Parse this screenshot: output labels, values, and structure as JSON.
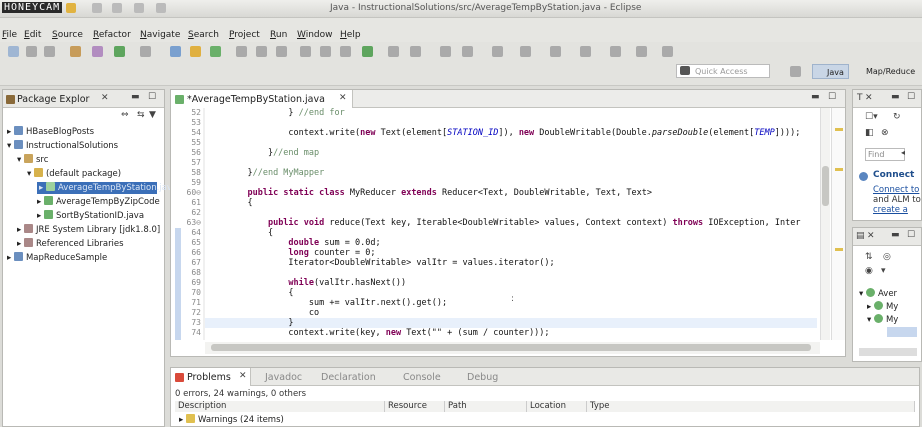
{
  "watermark": "HONEYCAM",
  "window_title": "Java - InstructionalSolutions/src/AverageTempByStation.java - Eclipse",
  "menu": [
    "File",
    "Edit",
    "Source",
    "Refactor",
    "Navigate",
    "Search",
    "Project",
    "Run",
    "Window",
    "Help"
  ],
  "quick_access_placeholder": "Quick Access",
  "perspectives": [
    "Java",
    "Map/Reduce"
  ],
  "package_explorer": {
    "title": "Package Explor",
    "items": [
      {
        "label": "HBaseBlogPosts",
        "level": 0
      },
      {
        "label": "InstructionalSolutions",
        "level": 0
      },
      {
        "label": "src",
        "level": 1
      },
      {
        "label": "(default package)",
        "level": 2
      },
      {
        "label": "AverageTempByStation.java",
        "level": 3
      },
      {
        "label": "AverageTempByZipCode",
        "level": 3
      },
      {
        "label": "SortByStationID.java",
        "level": 3
      },
      {
        "label": "JRE System Library [jdk1.8.0]",
        "level": 1
      },
      {
        "label": "Referenced Libraries",
        "level": 1
      },
      {
        "label": "MapReduceSample",
        "level": 0
      }
    ]
  },
  "editor": {
    "tab": "*AverageTempByStation.java",
    "lines": [
      {
        "n": "52",
        "code": "            } //end for"
      },
      {
        "n": "53",
        "code": ""
      },
      {
        "n": "54",
        "code": "            context.write(new Text(element[STATION_ID]), new DoubleWritable(Double.parseDouble(element[TEMP])));"
      },
      {
        "n": "55",
        "code": ""
      },
      {
        "n": "56",
        "code": "        }//end map"
      },
      {
        "n": "57",
        "code": ""
      },
      {
        "n": "58",
        "code": "    }//end MyMapper"
      },
      {
        "n": "59",
        "code": ""
      },
      {
        "n": "60⊖",
        "code": "    public static class MyReducer extends Reducer<Text, DoubleWritable, Text, Text>"
      },
      {
        "n": "61",
        "code": "    {"
      },
      {
        "n": "62",
        "code": ""
      },
      {
        "n": "63⊖",
        "code": "        public void reduce(Text key, Iterable<DoubleWritable> values, Context context) throws IOException, Inter"
      },
      {
        "n": "64",
        "code": "        {"
      },
      {
        "n": "65",
        "code": "            double sum = 0.0d;"
      },
      {
        "n": "66",
        "code": "            long counter = 0;"
      },
      {
        "n": "67",
        "code": "            Iterator<DoubleWritable> valItr = values.iterator();"
      },
      {
        "n": "68",
        "code": ""
      },
      {
        "n": "69",
        "code": "            while(valItr.hasNext())"
      },
      {
        "n": "70",
        "code": "            {"
      },
      {
        "n": "71",
        "code": "                sum += valItr.next().get();"
      },
      {
        "n": "72",
        "code": "                co"
      },
      {
        "n": "73",
        "code": "            }"
      },
      {
        "n": "74",
        "code": "            context.write(key, new Text(\"\" + (sum / counter)));"
      }
    ]
  },
  "outline": {
    "find_placeholder": "Find",
    "connect_title": "Connect",
    "connect_text": [
      "Connect to",
      "and ALM to",
      "create a"
    ],
    "tree": [
      "Aver",
      "My",
      "My"
    ]
  },
  "problems": {
    "tabs": [
      "Problems",
      "Javadoc",
      "Declaration",
      "Console",
      "Debug"
    ],
    "summary": "0 errors, 24 warnings, 0 others",
    "columns": [
      "Description",
      "Resource",
      "Path",
      "Location",
      "Type"
    ],
    "rows": [
      "Warnings (24 items)"
    ]
  },
  "colors": {
    "keyword": "#7f0055",
    "comment": "#6a8e6a",
    "field": "#0000c0",
    "selection": "#e8f0fb"
  }
}
